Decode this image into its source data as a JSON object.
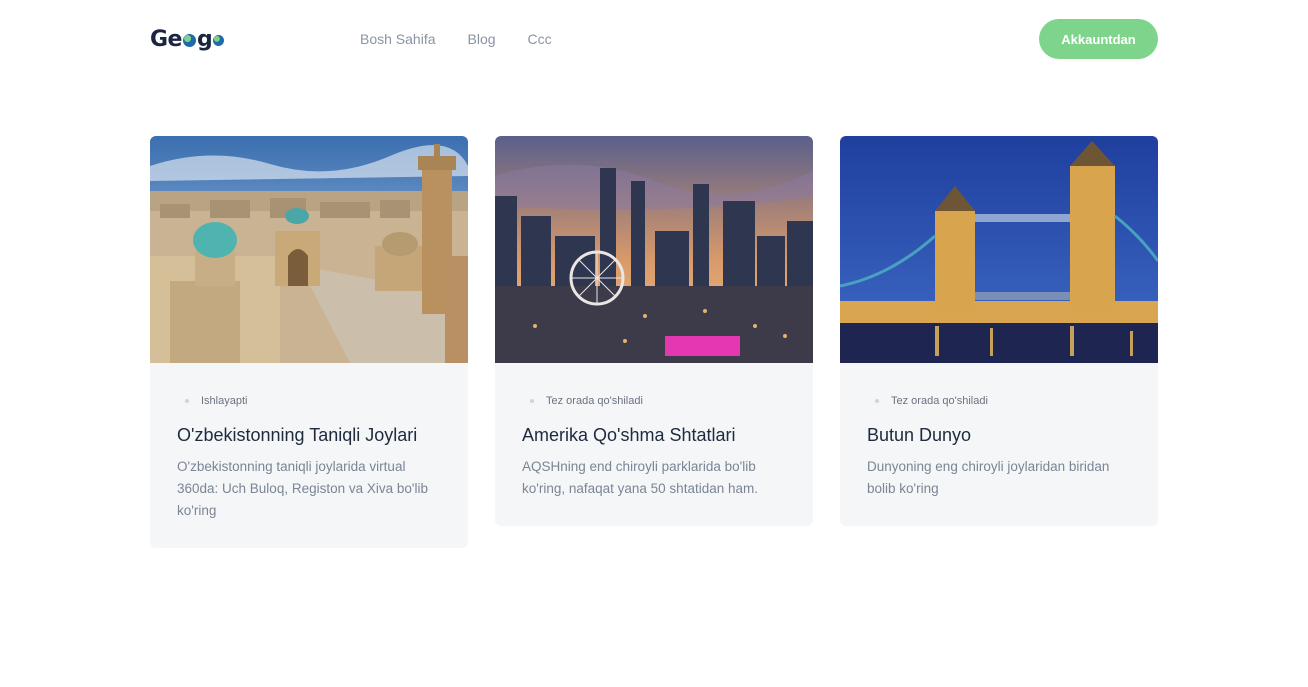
{
  "header": {
    "logo_text": "Geogo",
    "nav": [
      "Bosh Sahifa",
      "Blog",
      "Ccc"
    ],
    "cta_label": "Akkauntdan"
  },
  "cards": [
    {
      "status": "Ishlayapti",
      "title": "O'zbekistonning Taniqli Joylari",
      "description": "O'zbekistonning taniqli joylarida virtual 360da: Uch Buloq, Registon va Xiva bo'lib ko'ring",
      "image": "bukhara-old-city-photo"
    },
    {
      "status": "Tez orada qo'shiladi",
      "title": "Amerika Qo'shma Shtatlari",
      "description": "AQSHning end chiroyli parklarida bo'lib ko'ring, nafaqat yana 50 shtatidan ham.",
      "image": "atlanta-skyline-photo"
    },
    {
      "status": "Tez orada qo'shiladi",
      "title": "Butun Dunyo",
      "description": "Dunyoning eng chiroyli joylaridan biridan bolib ko'ring",
      "image": "tower-bridge-photo"
    }
  ]
}
